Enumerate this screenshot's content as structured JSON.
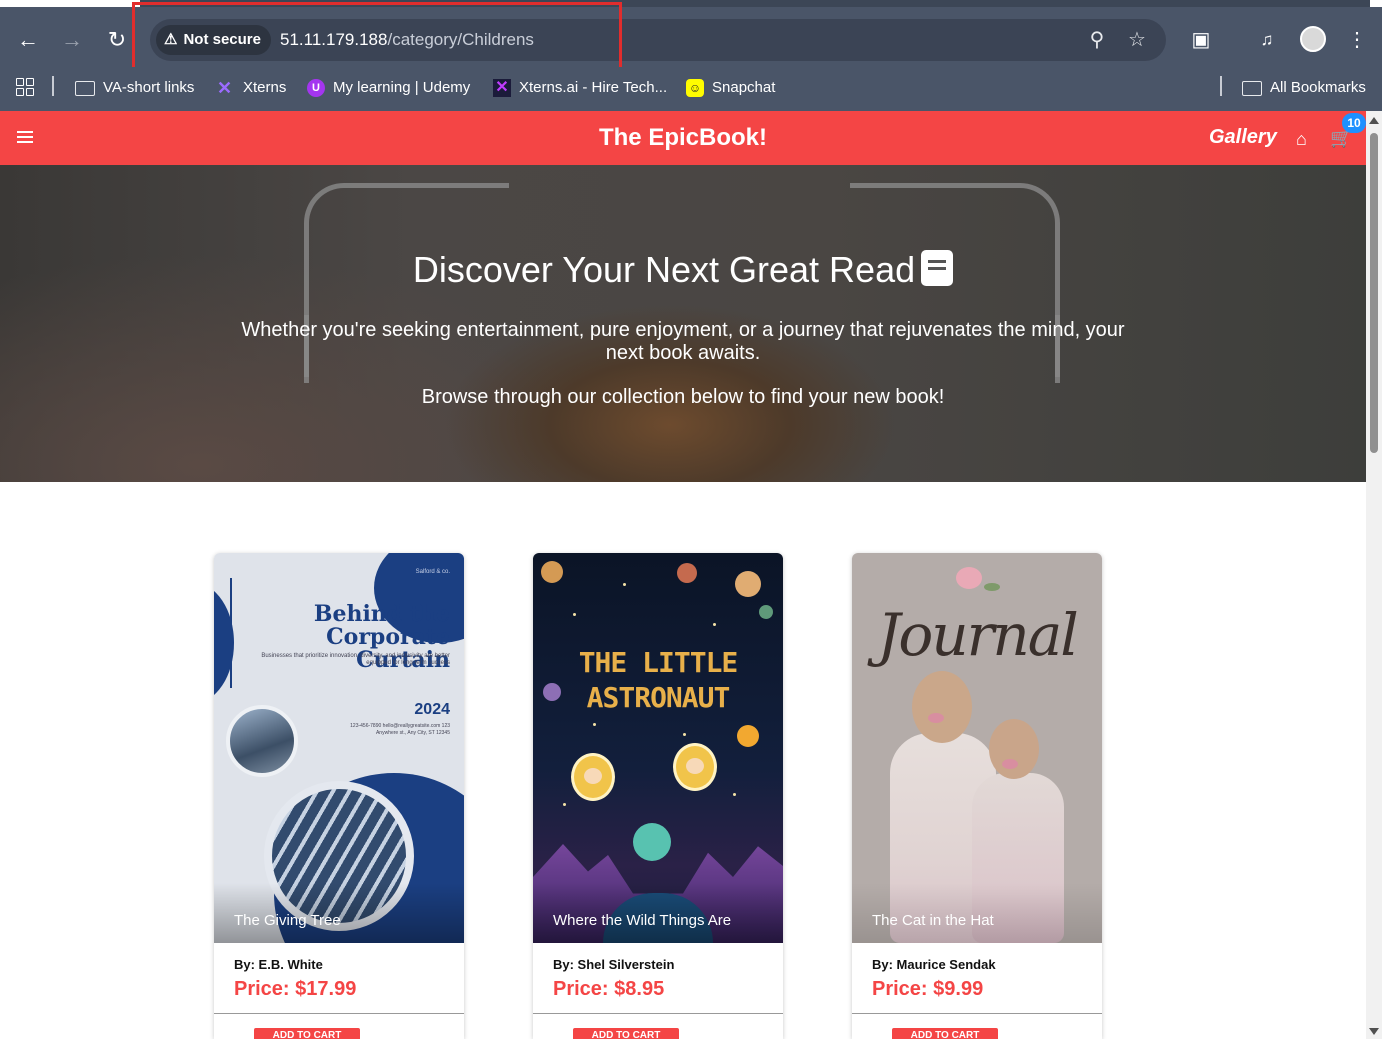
{
  "browser": {
    "security_label": "Not secure",
    "url_host": "51.11.179.188",
    "url_path": "/category/Childrens",
    "bookmarks": [
      {
        "label": "VA-short links",
        "icon": "folder-icon"
      },
      {
        "label": "Xterns",
        "icon": "xterns-icon"
      },
      {
        "label": "My learning | Udemy",
        "icon": "udemy-icon"
      },
      {
        "label": "Xterns.ai - Hire Tech...",
        "icon": "xterns-ai-icon"
      },
      {
        "label": "Snapchat",
        "icon": "snapchat-icon"
      }
    ],
    "all_bookmarks_label": "All Bookmarks"
  },
  "site": {
    "brand": "The EpicBook!",
    "gallery_label": "Gallery",
    "cart_count": "10",
    "accent_color": "#f44545"
  },
  "hero": {
    "heading": "Discover Your Next Great Read",
    "line1": "Whether you're seeking entertainment, pure enjoyment, or a journey that rejuvenates the mind, your next book awaits.",
    "line2": "Browse through our collection below to find your new book!"
  },
  "books": [
    {
      "title": "The Giving Tree",
      "author": "By: E.B. White",
      "price": "Price: $17.99",
      "button": "ADD TO CART",
      "cover_text": {
        "title": "Behind the Corporate Curtain",
        "subtitle": "Businesses that prioritize innovation, diversity, and inclusivity are better equipped for long-term success",
        "year": "2024",
        "contact": "123-456-7890 hello@reallygreatsite.com 123 Anywhere st., Any City, ST 12345",
        "publisher": "Salford & co."
      }
    },
    {
      "title": "Where the Wild Things Are",
      "author": "By: Shel Silverstein",
      "price": "Price: $8.95",
      "button": "ADD TO CART",
      "cover_text": {
        "title_line1": "THE LITTLE",
        "title_line2": "ASTRONAUT"
      }
    },
    {
      "title": "The Cat in the Hat",
      "author": "By: Maurice Sendak",
      "price": "Price: $9.99",
      "button": "ADD TO CART",
      "cover_text": {
        "title": "Journal"
      }
    }
  ]
}
